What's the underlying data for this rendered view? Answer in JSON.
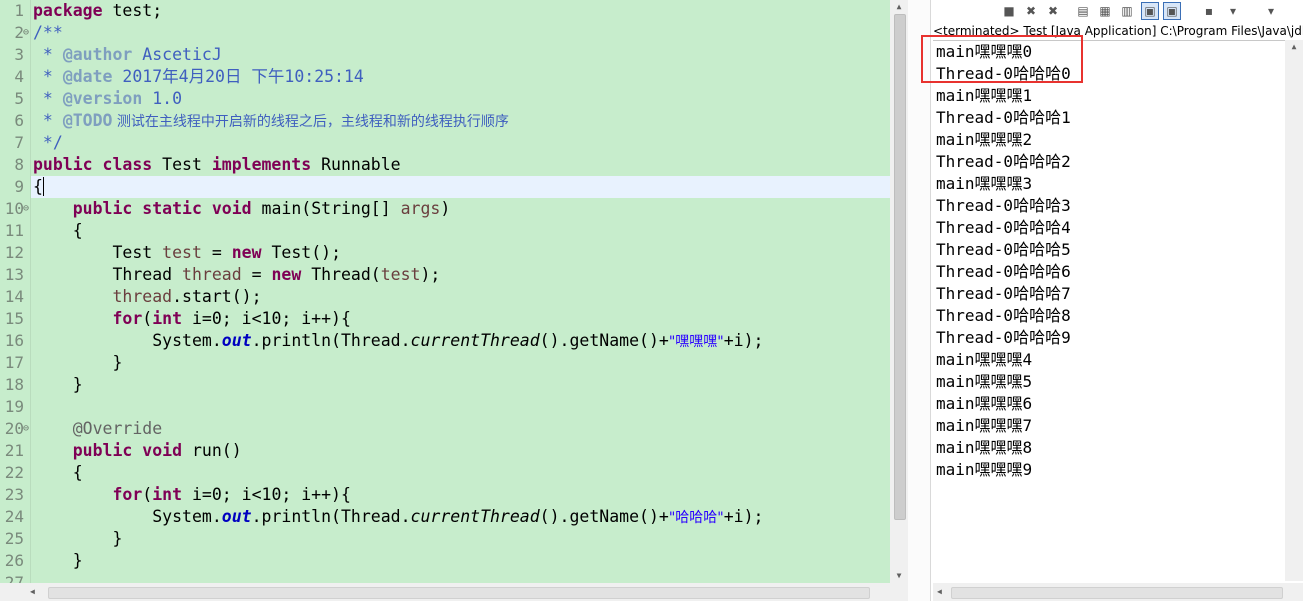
{
  "editor": {
    "line_numbers": [
      "1",
      "2",
      "3",
      "4",
      "5",
      "6",
      "7",
      "8",
      "9",
      "10",
      "11",
      "12",
      "13",
      "14",
      "15",
      "16",
      "17",
      "18",
      "19",
      "20",
      "21",
      "22",
      "23",
      "24",
      "25",
      "26",
      "27"
    ],
    "code": {
      "l1_kw": "package",
      "l1_rest": " test;",
      "l2": "/**",
      "l3_pre": " * ",
      "l3_tag": "@author",
      "l3_val": " AsceticJ",
      "l4_pre": " * ",
      "l4_tag": "@date",
      "l4_val": " 2017年4月20日 下午10:25:14",
      "l5_pre": " * ",
      "l5_tag": "@version",
      "l5_val": " 1.0",
      "l6_pre": " * ",
      "l6_tag": "@TODO",
      "l6_val": " 测试在主线程中开启新的线程之后，主线程和新的线程执行顺序",
      "l7": " */",
      "l8_kw1": "public",
      "l8_kw2": "class",
      "l8_name": " Test ",
      "l8_kw3": "implements",
      "l8_iface": " Runnable",
      "l9": "{",
      "l10_kw1": "public",
      "l10_kw2": "static",
      "l10_kw3": "void",
      "l10_mid": " main(String[] ",
      "l10_arg": "args",
      "l10_end": ")",
      "l11": "{",
      "l12_a": "Test ",
      "l12_var": "test",
      "l12_b": " = ",
      "l12_kw": "new",
      "l12_c": " Test();",
      "l13_a": "Thread ",
      "l13_var": "thread",
      "l13_b": " = ",
      "l13_kw": "new",
      "l13_c": " Thread(",
      "l13_arg": "test",
      "l13_d": ");",
      "l14_var": "thread",
      "l14_rest": ".start();",
      "l15_kw1": "for",
      "l15_a": "(",
      "l15_kw2": "int",
      "l15_b": " i=0; i<10; i++){",
      "l16_a": "System.",
      "l16_fld": "out",
      "l16_b": ".println(Thread.",
      "l16_st": "currentThread",
      "l16_c": "().getName()+",
      "l16_str": "\"嘿嘿嘿\"",
      "l16_d": "+i);",
      "l17": "}",
      "l18": "}",
      "l20": "@Override",
      "l21_kw1": "public",
      "l21_kw2": "void",
      "l21_rest": " run()",
      "l22": "{",
      "l23_kw1": "for",
      "l23_a": "(",
      "l23_kw2": "int",
      "l23_b": " i=0; i<10; i++){",
      "l24_a": "System.",
      "l24_fld": "out",
      "l24_b": ".println(Thread.",
      "l24_st": "currentThread",
      "l24_c": "().getName()+",
      "l24_str": "\"哈哈哈\"",
      "l24_d": "+i);",
      "l25": "}",
      "l26": "}"
    }
  },
  "console": {
    "status": "<terminated> Test [Java Application] C:\\Program Files\\Java\\jdk",
    "toolbar_icons": [
      "terminate-icon",
      "remove-launch-icon",
      "remove-all-terminated-icon",
      "clear-console-icon",
      "scroll-lock-icon",
      "word-wrap-icon",
      "show-stdout-icon",
      "show-stderr-icon",
      "pin-console-icon",
      "display-selected-console-icon",
      "open-console-icon"
    ],
    "output": [
      "main嘿嘿嘿0",
      "Thread-0哈哈哈0",
      "main嘿嘿嘿1",
      "Thread-0哈哈哈1",
      "main嘿嘿嘿2",
      "Thread-0哈哈哈2",
      "main嘿嘿嘿3",
      "Thread-0哈哈哈3",
      "Thread-0哈哈哈4",
      "Thread-0哈哈哈5",
      "Thread-0哈哈哈6",
      "Thread-0哈哈哈7",
      "Thread-0哈哈哈8",
      "Thread-0哈哈哈9",
      "main嘿嘿嘿4",
      "main嘿嘿嘿5",
      "main嘿嘿嘿6",
      "main嘿嘿嘿7",
      "main嘿嘿嘿8",
      "main嘿嘿嘿9"
    ]
  },
  "colors": {
    "editor_bg": "#c7edcc",
    "keyword": "#7f0055",
    "comment": "#3f5fbf",
    "string": "#2a00ff",
    "highlight_box": "#e8322f"
  }
}
